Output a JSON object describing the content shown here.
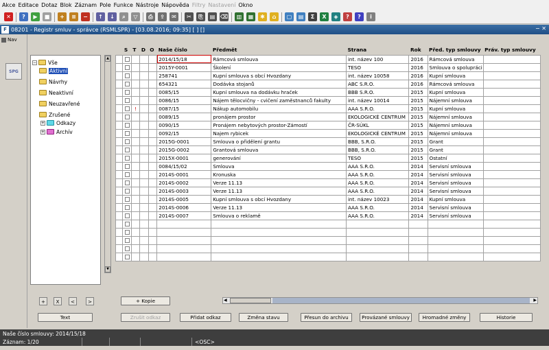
{
  "menu": [
    "Akce",
    "Editace",
    "Dotaz",
    "Blok",
    "Záznam",
    "Pole",
    "Funkce",
    "Nástroje",
    "Nápověda",
    "Filtry",
    "Nastavení",
    "Okno"
  ],
  "menu_disabled": [
    "Filtry",
    "Nastavení"
  ],
  "window": {
    "title": "08201 - Registr smluv - správce (RSMLSPR) - [03.08.2016; 09:35] [ ] []",
    "icon_text": "F",
    "controls": "− ✕"
  },
  "nav": {
    "tab_label": "Nav",
    "spg_label": "SPG"
  },
  "tree": {
    "root": "Vše",
    "items": [
      "Aktivní",
      "Návrhy",
      "Neaktivní",
      "Neuzavřené",
      "Zrušené",
      "Odkazy",
      "Archív"
    ]
  },
  "grid": {
    "headers": [
      "S",
      "T",
      "D",
      "O",
      "Naše číslo",
      "Předmět",
      "Strana",
      "Rok",
      "Před. typ smlouvy",
      "Práv. typ smlouvy"
    ],
    "rows": [
      {
        "flag": "",
        "num": "2014/15/18",
        "subject": "Rámcová smlouva",
        "party": "int. název 100",
        "year": "2016",
        "type": "Rámcová smlouva"
      },
      {
        "flag": "",
        "num": "2015Y-0001",
        "subject": "Školení",
        "party": "TESO",
        "year": "2016",
        "type": "Smlouva o spolupráci"
      },
      {
        "flag": "",
        "num": "258741",
        "subject": "Kupní smlouva s obcí Hvozdany",
        "party": "int. název 10058",
        "year": "2016",
        "type": "Kupní smlouva"
      },
      {
        "flag": "",
        "num": "654321",
        "subject": "Dodávka stojanů",
        "party": "ABC S.R.O.",
        "year": "2016",
        "type": "Rámcová smlouva"
      },
      {
        "flag": "",
        "num": "0085/15",
        "subject": "Kupní smlouva na dodávku hraček",
        "party": "BBB S.R.O.",
        "year": "2015",
        "type": "Kupní smlouva"
      },
      {
        "flag": "",
        "num": "0086/15",
        "subject": "Nájem tělocvičny - cvičení zaměstnanců fakulty",
        "party": "int. název 10014",
        "year": "2015",
        "type": "Nájemní smlouva"
      },
      {
        "flag": "!",
        "num": "0087/15",
        "subject": "Nákup automobilu",
        "party": "AAA S.R.O.",
        "year": "2015",
        "type": "Kupní smlouva"
      },
      {
        "flag": "",
        "num": "0089/15",
        "subject": "pronájem prostor",
        "party": "EKOLOGICKÉ CENTRUM",
        "year": "2015",
        "type": "Nájemní smlouva"
      },
      {
        "flag": "",
        "num": "0090/15",
        "subject": "Pronájem nebytových prostor-Zámostí",
        "party": "ČR-SÚKL",
        "year": "2015",
        "type": "Nájemní smlouva"
      },
      {
        "flag": "",
        "num": "0092/15",
        "subject": "Najem rybicek",
        "party": "EKOLOGICKÉ CENTRUM",
        "year": "2015",
        "type": "Nájemní smlouva"
      },
      {
        "flag": "",
        "num": "2015G-0001",
        "subject": "Smlouva o přidělení grantu",
        "party": "BBB, S.R.O.",
        "year": "2015",
        "type": "Grant"
      },
      {
        "flag": "",
        "num": "2015G-0002",
        "subject": "Grantová smlouva",
        "party": "BBB, S.R.O.",
        "year": "2015",
        "type": "Grant"
      },
      {
        "flag": "",
        "num": "2015X-0001",
        "subject": "generování",
        "party": "TESO",
        "year": "2015",
        "type": "Ostatní"
      },
      {
        "flag": "",
        "num": "0084/15/02",
        "subject": "Smlouva",
        "party": "AAA S.R.O.",
        "year": "2014",
        "type": "Servisní smlouva"
      },
      {
        "flag": "",
        "num": "2014S-0001",
        "subject": "Kronuska",
        "party": "AAA S.R.O.",
        "year": "2014",
        "type": "Servisní smlouva"
      },
      {
        "flag": "",
        "num": "2014S-0002",
        "subject": "Verze 11.13",
        "party": "AAA S.R.O.",
        "year": "2014",
        "type": "Servisní smlouva"
      },
      {
        "flag": "",
        "num": "2014S-0003",
        "subject": "Verze 11.13",
        "party": "AAA S.R.O.",
        "year": "2014",
        "type": "Servisní smlouva"
      },
      {
        "flag": "",
        "num": "2014S-0005",
        "subject": "Kupní smlouva s obcí Hvozdany",
        "party": "int. název 10023",
        "year": "2014",
        "type": "Kupní smlouva"
      },
      {
        "flag": "",
        "num": "2014S-0006",
        "subject": "Verze 11.13",
        "party": "AAA S.R.O.",
        "year": "2014",
        "type": "Servisní smlouva"
      },
      {
        "flag": "",
        "num": "2014S-0007",
        "subject": "Smlouva o reklamě",
        "party": "AAA S.R.O.",
        "year": "2014",
        "type": "Servisní smlouva"
      }
    ],
    "empty_rows": 5
  },
  "small_buttons": [
    "+",
    "X",
    "<",
    ">"
  ],
  "kopie_button": "+ Kopie",
  "buttons": {
    "text": "Text",
    "zrusit_odkaz": "Zrušit odkaz",
    "pridat_odkaz": "Přidat odkaz",
    "zmena_stavu": "Změna stavu",
    "presun": "Přesun do archivu",
    "provazane": "Provázané smlouvy",
    "hromadne": "Hromadné změny",
    "historie": "Historie"
  },
  "status": {
    "line1": "Naše číslo smlouvy: 2014/15/18",
    "record": "Záznam: 1/20",
    "osc": "<OSC>"
  }
}
